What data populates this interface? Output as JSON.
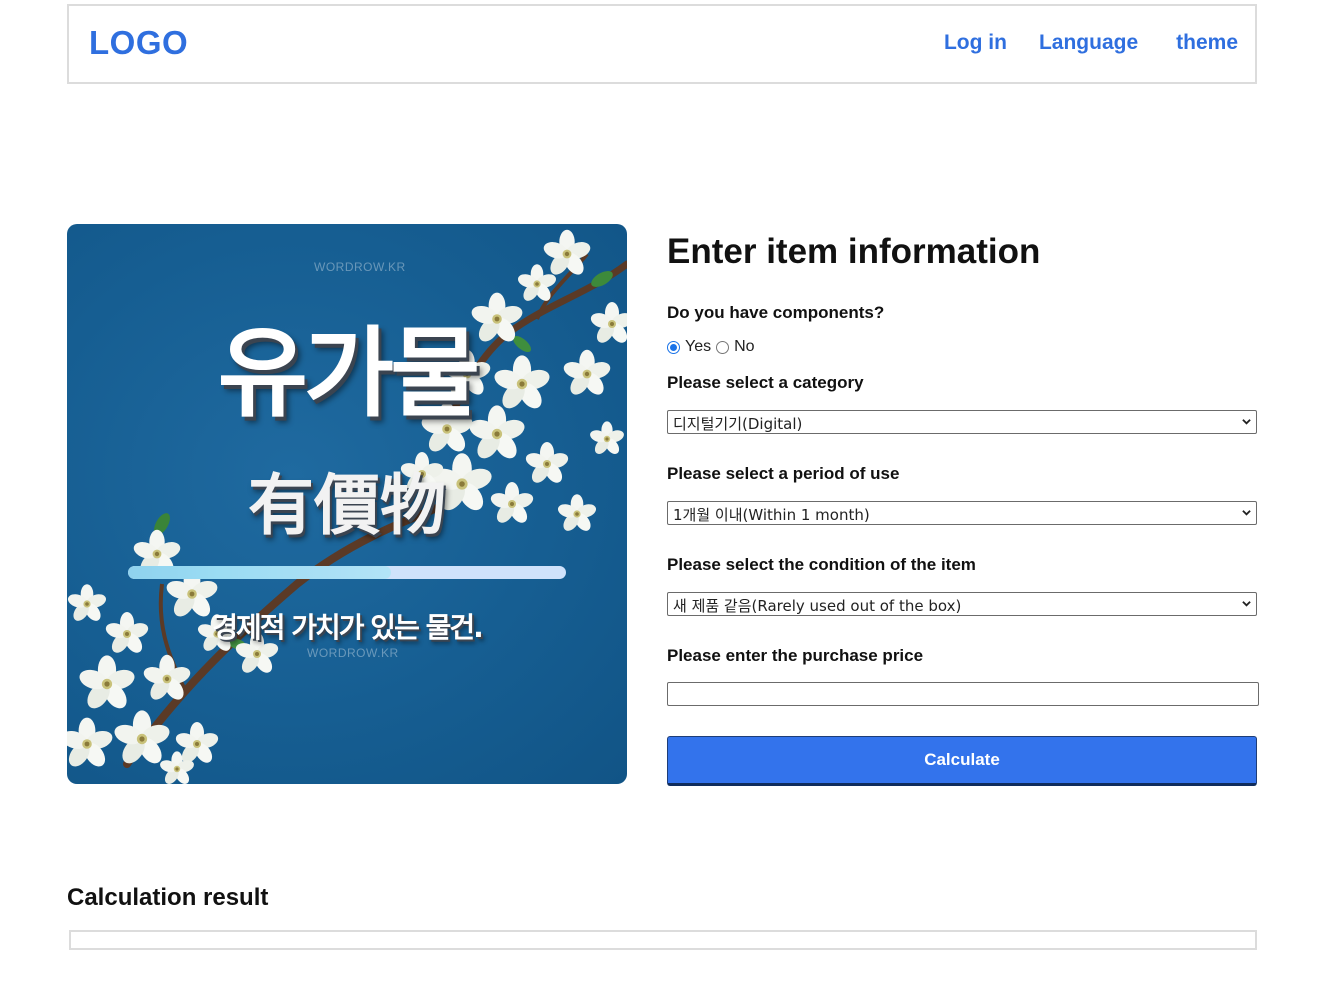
{
  "header": {
    "logo": "LOGO",
    "nav": {
      "login": "Log in",
      "language": "Language",
      "theme": "theme"
    }
  },
  "hero": {
    "watermark_top": "WORDROW.KR",
    "watermark_bottom": "WORDROW.KR",
    "title_korean": "유가물",
    "title_hanja": "有價物",
    "caption": "경제적 가치가 있는 물건.",
    "progress_fraction": 0.6
  },
  "form": {
    "title": "Enter item information",
    "components": {
      "label": "Do you have components?",
      "options": [
        "Yes",
        "No"
      ],
      "selected": "Yes"
    },
    "category": {
      "label": "Please select a category",
      "selected": "디지털기기(Digital)"
    },
    "period": {
      "label": "Please select a period of use",
      "selected": "1개월 이내(Within 1 month)"
    },
    "condition": {
      "label": "Please select the condition of the item",
      "selected": "새 제품 같음(Rarely used out of the box)"
    },
    "price": {
      "label": "Please enter the purchase price",
      "value": ""
    },
    "button": "Calculate"
  },
  "result": {
    "title": "Calculation result",
    "value": ""
  },
  "colors": {
    "accent": "#2f6fdf",
    "button": "#3373ec",
    "hero_background": "#165e92"
  }
}
